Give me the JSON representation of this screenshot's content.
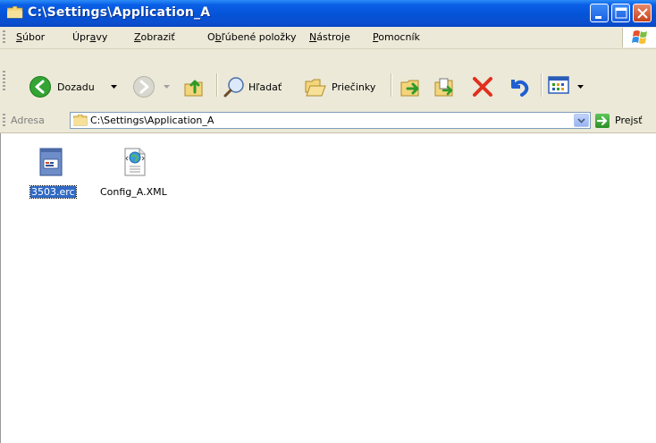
{
  "window": {
    "title": "C:\\Settings\\Application_A"
  },
  "menu": {
    "items": [
      {
        "pre": "",
        "key": "S",
        "post": "úbor"
      },
      {
        "pre": "Úpr",
        "key": "a",
        "post": "vy"
      },
      {
        "pre": "",
        "key": "Z",
        "post": "obraziť"
      },
      {
        "pre": "O",
        "key": "b",
        "post": "ľúbené položky"
      },
      {
        "pre": "",
        "key": "N",
        "post": "ástroje"
      },
      {
        "pre": "",
        "key": "P",
        "post": "omocník"
      }
    ]
  },
  "toolbar": {
    "back_label": "Dozadu",
    "search_label": "Hľadať",
    "folders_label": "Priečinky"
  },
  "address": {
    "label": "Adresa",
    "path": "C:\\Settings\\Application_A",
    "go_label": "Prejsť"
  },
  "files": [
    {
      "name": "3503.erc",
      "selected": true,
      "icon": "erc-file-icon"
    },
    {
      "name": "Config_A.XML",
      "selected": false,
      "icon": "xml-file-icon"
    }
  ],
  "colors": {
    "titlebar": "#0553d7",
    "chrome": "#ece9d8",
    "selection": "#316ac5"
  }
}
